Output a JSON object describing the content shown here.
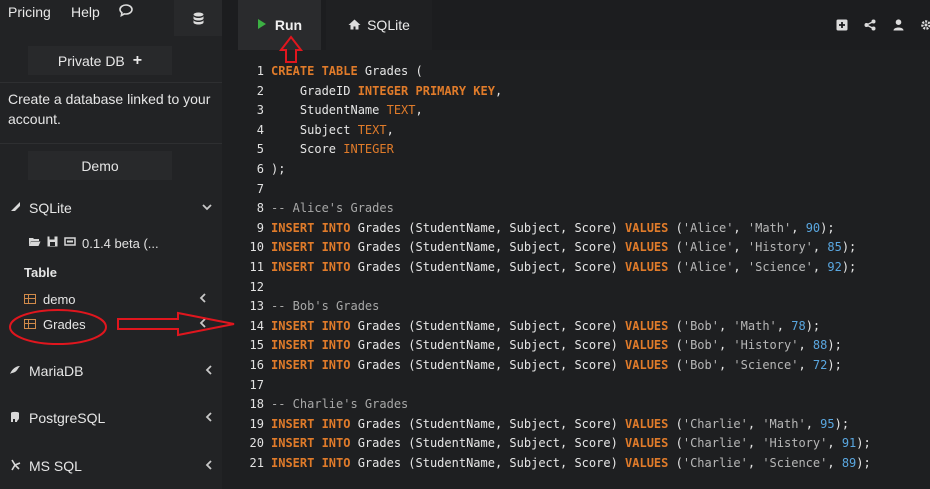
{
  "nav": {
    "pricing": "Pricing",
    "help": "Help"
  },
  "sidebar": {
    "private_db": "Private DB",
    "create_text": "Create a database linked to your account.",
    "demo": "Demo",
    "sqlite": "SQLite",
    "version": "0.1.4 beta (...",
    "table_header": "Table",
    "tables": [
      {
        "label": "demo"
      },
      {
        "label": "Grades"
      }
    ],
    "other_dbs": [
      {
        "label": "MariaDB"
      },
      {
        "label": "PostgreSQL"
      },
      {
        "label": "MS SQL"
      }
    ]
  },
  "toolbar": {
    "run": "Run",
    "engine": "SQLite"
  },
  "colors": {
    "keyword": "#e07b2a",
    "number": "#5aa7e0",
    "run_icon": "#3cb043",
    "annotation": "#e0161e"
  },
  "icons": [
    "bars-icon",
    "comment-icon",
    "database-icon",
    "plus-icon",
    "play-icon",
    "home-icon",
    "plus-square-icon",
    "share-icon",
    "user-icon",
    "gear-icon",
    "folder-open-icon",
    "save-icon",
    "table-icon",
    "chevron-down-icon",
    "chevron-left-icon"
  ],
  "code": [
    {
      "n": "1",
      "t": [
        [
          "kw",
          "CREATE TABLE"
        ],
        [
          "p",
          " Grades ("
        ]
      ]
    },
    {
      "n": "2",
      "t": [
        [
          "p",
          "    GradeID "
        ],
        [
          "kw",
          "INTEGER PRIMARY KEY"
        ],
        [
          "p",
          ","
        ]
      ]
    },
    {
      "n": "3",
      "t": [
        [
          "p",
          "    StudentName "
        ],
        [
          "ty",
          "TEXT"
        ],
        [
          "p",
          ","
        ]
      ]
    },
    {
      "n": "4",
      "t": [
        [
          "p",
          "    Subject "
        ],
        [
          "ty",
          "TEXT"
        ],
        [
          "p",
          ","
        ]
      ]
    },
    {
      "n": "5",
      "t": [
        [
          "p",
          "    Score "
        ],
        [
          "ty",
          "INTEGER"
        ]
      ]
    },
    {
      "n": "6",
      "t": [
        [
          "p",
          ");"
        ]
      ]
    },
    {
      "n": "7",
      "t": []
    },
    {
      "n": "8",
      "t": [
        [
          "cmt",
          "-- Alice's Grades"
        ]
      ]
    },
    {
      "n": "9",
      "t": [
        [
          "kw",
          "INSERT INTO"
        ],
        [
          "p",
          " Grades (StudentName, Subject, Score) "
        ],
        [
          "kw",
          "VALUES"
        ],
        [
          "p",
          " ("
        ],
        [
          "str",
          "'Alice'"
        ],
        [
          "p",
          ", "
        ],
        [
          "str",
          "'Math'"
        ],
        [
          "p",
          ", "
        ],
        [
          "num",
          "90"
        ],
        [
          "p",
          ");"
        ]
      ]
    },
    {
      "n": "10",
      "t": [
        [
          "kw",
          "INSERT INTO"
        ],
        [
          "p",
          " Grades (StudentName, Subject, Score) "
        ],
        [
          "kw",
          "VALUES"
        ],
        [
          "p",
          " ("
        ],
        [
          "str",
          "'Alice'"
        ],
        [
          "p",
          ", "
        ],
        [
          "str",
          "'History'"
        ],
        [
          "p",
          ", "
        ],
        [
          "num",
          "85"
        ],
        [
          "p",
          ");"
        ]
      ]
    },
    {
      "n": "11",
      "t": [
        [
          "kw",
          "INSERT INTO"
        ],
        [
          "p",
          " Grades (StudentName, Subject, Score) "
        ],
        [
          "kw",
          "VALUES"
        ],
        [
          "p",
          " ("
        ],
        [
          "str",
          "'Alice'"
        ],
        [
          "p",
          ", "
        ],
        [
          "str",
          "'Science'"
        ],
        [
          "p",
          ", "
        ],
        [
          "num",
          "92"
        ],
        [
          "p",
          ");"
        ]
      ]
    },
    {
      "n": "12",
      "t": []
    },
    {
      "n": "13",
      "t": [
        [
          "cmt",
          "-- Bob's Grades"
        ]
      ]
    },
    {
      "n": "14",
      "t": [
        [
          "kw",
          "INSERT INTO"
        ],
        [
          "p",
          " Grades (StudentName, Subject, Score) "
        ],
        [
          "kw",
          "VALUES"
        ],
        [
          "p",
          " ("
        ],
        [
          "str",
          "'Bob'"
        ],
        [
          "p",
          ", "
        ],
        [
          "str",
          "'Math'"
        ],
        [
          "p",
          ", "
        ],
        [
          "num",
          "78"
        ],
        [
          "p",
          ");"
        ]
      ]
    },
    {
      "n": "15",
      "t": [
        [
          "kw",
          "INSERT INTO"
        ],
        [
          "p",
          " Grades (StudentName, Subject, Score) "
        ],
        [
          "kw",
          "VALUES"
        ],
        [
          "p",
          " ("
        ],
        [
          "str",
          "'Bob'"
        ],
        [
          "p",
          ", "
        ],
        [
          "str",
          "'History'"
        ],
        [
          "p",
          ", "
        ],
        [
          "num",
          "88"
        ],
        [
          "p",
          ");"
        ]
      ]
    },
    {
      "n": "16",
      "t": [
        [
          "kw",
          "INSERT INTO"
        ],
        [
          "p",
          " Grades (StudentName, Subject, Score) "
        ],
        [
          "kw",
          "VALUES"
        ],
        [
          "p",
          " ("
        ],
        [
          "str",
          "'Bob'"
        ],
        [
          "p",
          ", "
        ],
        [
          "str",
          "'Science'"
        ],
        [
          "p",
          ", "
        ],
        [
          "num",
          "72"
        ],
        [
          "p",
          ");"
        ]
      ]
    },
    {
      "n": "17",
      "t": []
    },
    {
      "n": "18",
      "t": [
        [
          "cmt",
          "-- Charlie's Grades"
        ]
      ]
    },
    {
      "n": "19",
      "t": [
        [
          "kw",
          "INSERT INTO"
        ],
        [
          "p",
          " Grades (StudentName, Subject, Score) "
        ],
        [
          "kw",
          "VALUES"
        ],
        [
          "p",
          " ("
        ],
        [
          "str",
          "'Charlie'"
        ],
        [
          "p",
          ", "
        ],
        [
          "str",
          "'Math'"
        ],
        [
          "p",
          ", "
        ],
        [
          "num",
          "95"
        ],
        [
          "p",
          ");"
        ]
      ]
    },
    {
      "n": "20",
      "t": [
        [
          "kw",
          "INSERT INTO"
        ],
        [
          "p",
          " Grades (StudentName, Subject, Score) "
        ],
        [
          "kw",
          "VALUES"
        ],
        [
          "p",
          " ("
        ],
        [
          "str",
          "'Charlie'"
        ],
        [
          "p",
          ", "
        ],
        [
          "str",
          "'History'"
        ],
        [
          "p",
          ", "
        ],
        [
          "num",
          "91"
        ],
        [
          "p",
          ");"
        ]
      ]
    },
    {
      "n": "21",
      "t": [
        [
          "kw",
          "INSERT INTO"
        ],
        [
          "p",
          " Grades (StudentName, Subject, Score) "
        ],
        [
          "kw",
          "VALUES"
        ],
        [
          "p",
          " ("
        ],
        [
          "str",
          "'Charlie'"
        ],
        [
          "p",
          ", "
        ],
        [
          "str",
          "'Science'"
        ],
        [
          "p",
          ", "
        ],
        [
          "num",
          "89"
        ],
        [
          "p",
          ");"
        ]
      ]
    }
  ]
}
